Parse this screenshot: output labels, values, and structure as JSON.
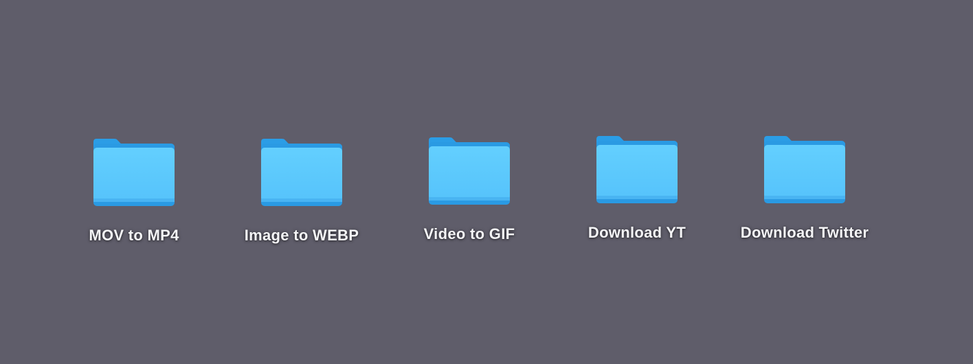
{
  "desktop": {
    "background_color": "#5f5d6a",
    "folder_color": "#5ccafd",
    "folder_tab_color": "#2fa4ea",
    "items": [
      {
        "label": "MOV to MP4",
        "icon": "folder-icon"
      },
      {
        "label": "Image to WEBP",
        "icon": "folder-icon"
      },
      {
        "label": "Video to GIF",
        "icon": "folder-icon"
      },
      {
        "label": "Download YT",
        "icon": "folder-icon"
      },
      {
        "label": "Download Twitter",
        "icon": "folder-icon"
      }
    ]
  }
}
